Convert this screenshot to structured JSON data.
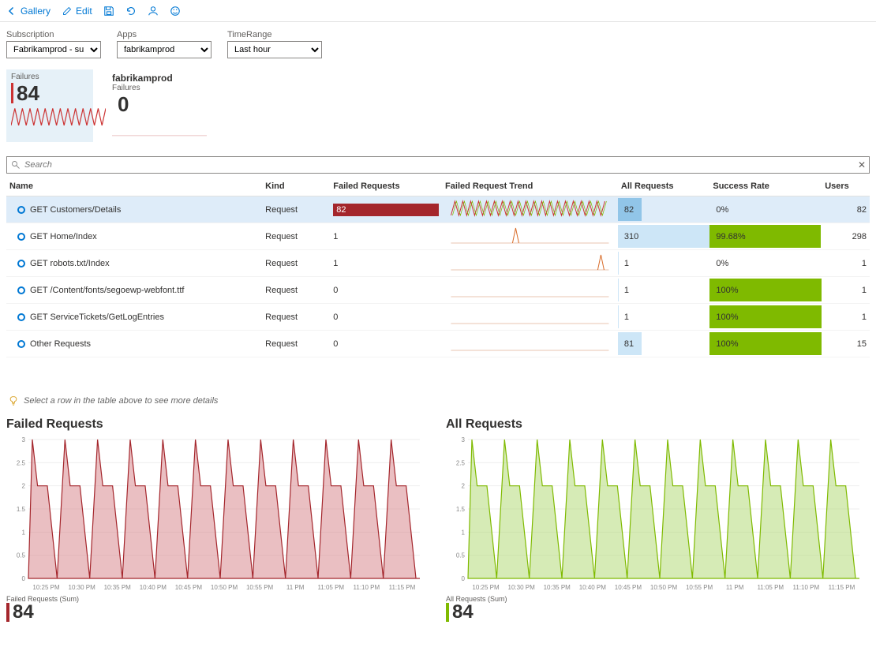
{
  "toolbar": {
    "gallery": "Gallery",
    "edit": "Edit"
  },
  "filters": {
    "subscription": {
      "label": "Subscription",
      "value": "Fabrikamprod - subscripti..."
    },
    "apps": {
      "label": "Apps",
      "value": "fabrikamprod"
    },
    "timerange": {
      "label": "TimeRange",
      "value": "Last hour"
    }
  },
  "cards": {
    "failures": {
      "title": "Failures",
      "value": "84"
    },
    "app": {
      "title": "fabrikamprod",
      "subtitle": "Failures",
      "value": "0"
    }
  },
  "search": {
    "placeholder": "Search"
  },
  "table": {
    "headers": {
      "name": "Name",
      "kind": "Kind",
      "failed": "Failed Requests",
      "trend": "Failed Request Trend",
      "all": "All Requests",
      "success": "Success Rate",
      "users": "Users"
    },
    "rows": [
      {
        "name": "GET Customers/Details",
        "kind": "Request",
        "failed": "82",
        "failed_bar_pct": 100,
        "all": "82",
        "all_pct": 26,
        "success": "0%",
        "success_pct": 0,
        "users": "82",
        "selected": true,
        "trend_type": "dense"
      },
      {
        "name": "GET Home/Index",
        "kind": "Request",
        "failed": "1",
        "failed_bar_pct": 0,
        "all": "310",
        "all_pct": 100,
        "success": "99.68%",
        "success_pct": 99,
        "users": "298",
        "trend_type": "spike-mid"
      },
      {
        "name": "GET robots.txt/Index",
        "kind": "Request",
        "failed": "1",
        "failed_bar_pct": 0,
        "all": "1",
        "all_pct": 1,
        "success": "0%",
        "success_pct": 0,
        "users": "1",
        "trend_type": "spike-right"
      },
      {
        "name": "GET /Content/fonts/segoewp-webfont.ttf",
        "kind": "Request",
        "failed": "0",
        "failed_bar_pct": 0,
        "all": "1",
        "all_pct": 1,
        "success": "100%",
        "success_pct": 100,
        "users": "1",
        "trend_type": "flat"
      },
      {
        "name": "GET ServiceTickets/GetLogEntries",
        "kind": "Request",
        "failed": "0",
        "failed_bar_pct": 0,
        "all": "1",
        "all_pct": 1,
        "success": "100%",
        "success_pct": 100,
        "users": "1",
        "trend_type": "flat"
      },
      {
        "name": "Other Requests",
        "kind": "Request",
        "failed": "0",
        "failed_bar_pct": 0,
        "all": "81",
        "all_pct": 26,
        "success": "100%",
        "success_pct": 100,
        "users": "15",
        "trend_type": "flat"
      }
    ]
  },
  "hint": "Select a row in the table above to see more details",
  "charts": {
    "left": {
      "title": "Failed Requests",
      "footer_label": "Failed Requests (Sum)",
      "footer_value": "84",
      "color": "#a4262c",
      "fill": "#d88b8f"
    },
    "right": {
      "title": "All Requests",
      "footer_label": "All Requests (Sum)",
      "footer_value": "84",
      "color": "#7fba00",
      "fill": "#b4da7a"
    }
  },
  "chart_data": {
    "type": "area",
    "x_ticks": [
      "10:25 PM",
      "10:30 PM",
      "10:35 PM",
      "10:40 PM",
      "10:45 PM",
      "10:50 PM",
      "10:55 PM",
      "11 PM",
      "11:05 PM",
      "11:10 PM",
      "11:15 PM"
    ],
    "y_ticks": [
      0,
      0.5,
      1,
      1.5,
      2,
      2.5,
      3
    ],
    "ylim": [
      0,
      3
    ],
    "series": [
      {
        "name": "Failed Requests (Sum)",
        "pattern": "repeating-sawtooth",
        "peak": 3,
        "step_level": 2,
        "trough": 0,
        "cycles": 12
      },
      {
        "name": "All Requests (Sum)",
        "pattern": "repeating-sawtooth",
        "peak": 3,
        "step_level": 2,
        "trough": 0,
        "cycles": 12
      }
    ]
  }
}
